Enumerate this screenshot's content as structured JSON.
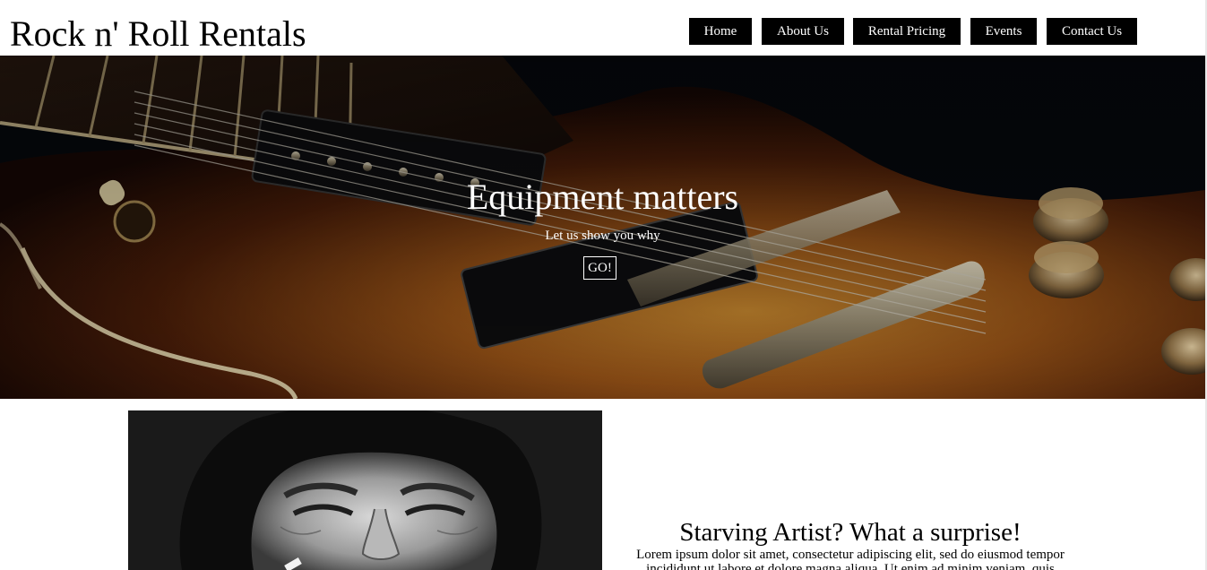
{
  "header": {
    "site_title": "Rock n' Roll Rentals"
  },
  "nav": {
    "items": [
      {
        "label": "Home"
      },
      {
        "label": "About Us"
      },
      {
        "label": "Rental Pricing"
      },
      {
        "label": "Events"
      },
      {
        "label": "Contact Us"
      }
    ]
  },
  "hero": {
    "title": "Equipment matters",
    "subtitle": "Let us show you why",
    "button_label": "GO!",
    "image": "electric-guitar-sunburst-photo"
  },
  "feature": {
    "image": "smiling-man-smoking-bw-photo",
    "title": "Starving Artist? What a surprise!",
    "body": "Lorem ipsum dolor sit amet, consectetur adipiscing elit, sed do eiusmod tempor incididunt ut labore et dolore magna aliqua. Ut enim ad minim veniam, quis"
  },
  "colors": {
    "nav_bg": "#000000",
    "nav_text": "#ffffff",
    "hero_text": "#ffffff",
    "guitar_body": "#8a4a14"
  }
}
